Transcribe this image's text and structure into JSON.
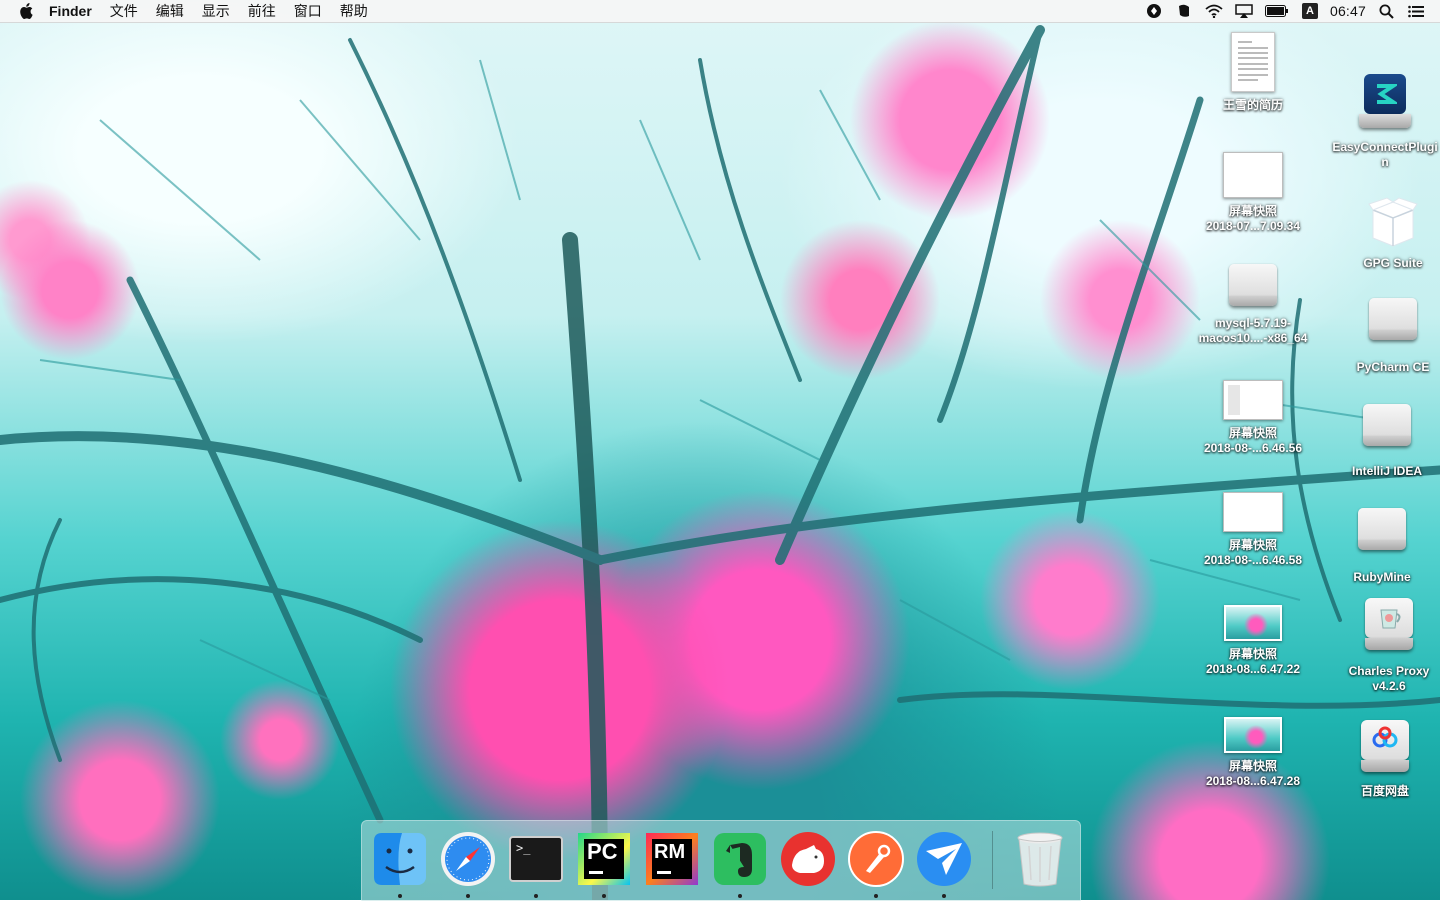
{
  "menubar": {
    "app_name": "Finder",
    "menus": [
      "文件",
      "编辑",
      "显示",
      "前往",
      "窗口",
      "帮助"
    ],
    "input_method": "A",
    "clock": "06:47"
  },
  "desktop": {
    "left_column": [
      {
        "line1": "王雪的简历",
        "line2": "",
        "kind": "document"
      },
      {
        "line1": "屏幕快照",
        "line2": "2018-07...7.09.34",
        "kind": "screenshot"
      },
      {
        "line1": "mysql-5.7.19-",
        "line2": "macos10....-x86_64",
        "kind": "disk"
      },
      {
        "line1": "屏幕快照",
        "line2": "2018-08-...6.46.56",
        "kind": "screenshot"
      },
      {
        "line1": "屏幕快照",
        "line2": "2018-08-...6.46.58",
        "kind": "screenshot"
      },
      {
        "line1": "屏幕快照",
        "line2": "2018-08...6.47.22",
        "kind": "photo"
      },
      {
        "line1": "屏幕快照",
        "line2": "2018-08...6.47.28",
        "kind": "photo"
      }
    ],
    "right_column": [
      {
        "line1": "EasyConnectPlugi",
        "line2": "n",
        "kind": "easyconnect"
      },
      {
        "line1": "GPG Suite",
        "line2": "",
        "kind": "gpg"
      },
      {
        "line1": "PyCharm CE",
        "line2": "",
        "kind": "disk"
      },
      {
        "line1": "IntelliJ IDEA",
        "line2": "",
        "kind": "disk"
      },
      {
        "line1": "RubyMine",
        "line2": "",
        "kind": "disk"
      },
      {
        "line1": "Charles Proxy",
        "line2": "v4.2.6",
        "kind": "charles"
      },
      {
        "line1": "百度网盘",
        "line2": "",
        "kind": "baidu"
      }
    ]
  },
  "dock": {
    "apps": [
      {
        "name": "finder",
        "running": true
      },
      {
        "name": "safari",
        "running": true
      },
      {
        "name": "terminal",
        "running": true,
        "glyph": ">_"
      },
      {
        "name": "pycharm",
        "running": true,
        "glyph": "PC"
      },
      {
        "name": "rubymine",
        "running": false,
        "glyph": "RM"
      },
      {
        "name": "evernote",
        "running": true
      },
      {
        "name": "bear",
        "running": false
      },
      {
        "name": "postman",
        "running": true
      },
      {
        "name": "airmail",
        "running": true
      }
    ],
    "trash": "trash"
  },
  "colors": {
    "menubar_bg": "#f5f5f5",
    "dock_bg": "#bee1e1",
    "pycharm_green": "#21d789",
    "rubymine_red": "#fe2857",
    "evernote_green": "#2dbe60",
    "postman_orange": "#ff6c37",
    "airmail_blue": "#2a8ef2"
  }
}
